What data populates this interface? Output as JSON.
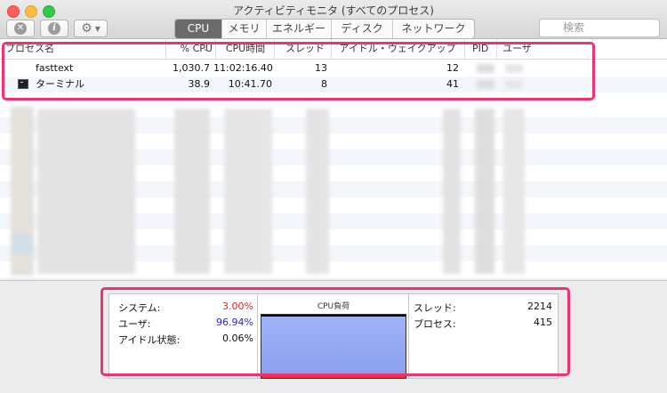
{
  "window": {
    "title": "アクティビティモニタ (すべてのプロセス)"
  },
  "tabs": [
    {
      "label": "CPU",
      "active": true
    },
    {
      "label": "メモリ",
      "active": false
    },
    {
      "label": "エネルギー",
      "active": false
    },
    {
      "label": "ディスク",
      "active": false
    },
    {
      "label": "ネットワーク",
      "active": false
    }
  ],
  "search": {
    "placeholder": "検索"
  },
  "table": {
    "columns": [
      "プロセス名",
      "% CPU",
      "CPU時間",
      "スレッド",
      "アイドル・ウェイクアップ",
      "PID",
      "ユーザ"
    ],
    "rows": [
      {
        "name": "fasttext",
        "cpu": "1,030.7",
        "time": "11:02:16.40",
        "threads": "13",
        "wakeups": "12"
      },
      {
        "name": "ターミナル",
        "cpu": "38.9",
        "time": "10:41.70",
        "threads": "8",
        "wakeups": "41"
      }
    ]
  },
  "stats": {
    "system_label": "システム:",
    "system_value": "3.00%",
    "user_label": "ユーザ:",
    "user_value": "96.94%",
    "idle_label": "アイドル状態:",
    "idle_value": "0.06%",
    "cpu_load_title": "CPU負荷",
    "threads_label": "スレッド:",
    "threads_value": "2214",
    "processes_label": "プロセス:",
    "processes_value": "415",
    "cpu_load_fraction": 0.97,
    "system_color": "#e0241b",
    "user_color": "#2424d8",
    "highlight_color": "#f0336e"
  }
}
